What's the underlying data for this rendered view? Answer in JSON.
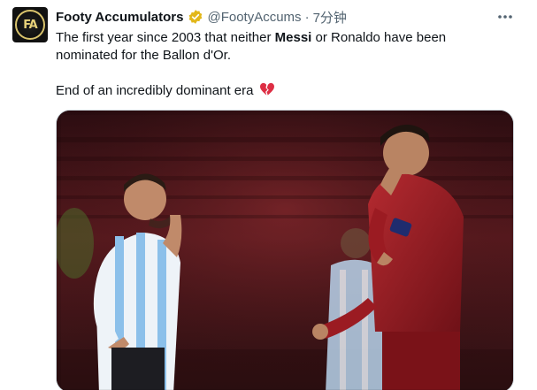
{
  "author": {
    "display_name": "Footy Accumulators",
    "handle": "@FootyAccums",
    "separator": "·",
    "time": "7分钟",
    "avatar_text": "FA",
    "verified_color": "#e2b719"
  },
  "tweet": {
    "line1_pre": "The first year since 2003 that neither ",
    "line1_bold": "Messi",
    "line1_post": " or Ronaldo have been",
    "line2": "nominated for the Ballon d'Or.",
    "line3": "End of an incredibly dominant era",
    "emoji": "broken-heart-icon"
  },
  "menu": {
    "more_label": "•••"
  },
  "media": {
    "description_icon": "photo",
    "colors": {
      "background": "#3a1216",
      "argentina_sky": "#9ec9ee",
      "portugal_red": "#9b1b22"
    }
  }
}
